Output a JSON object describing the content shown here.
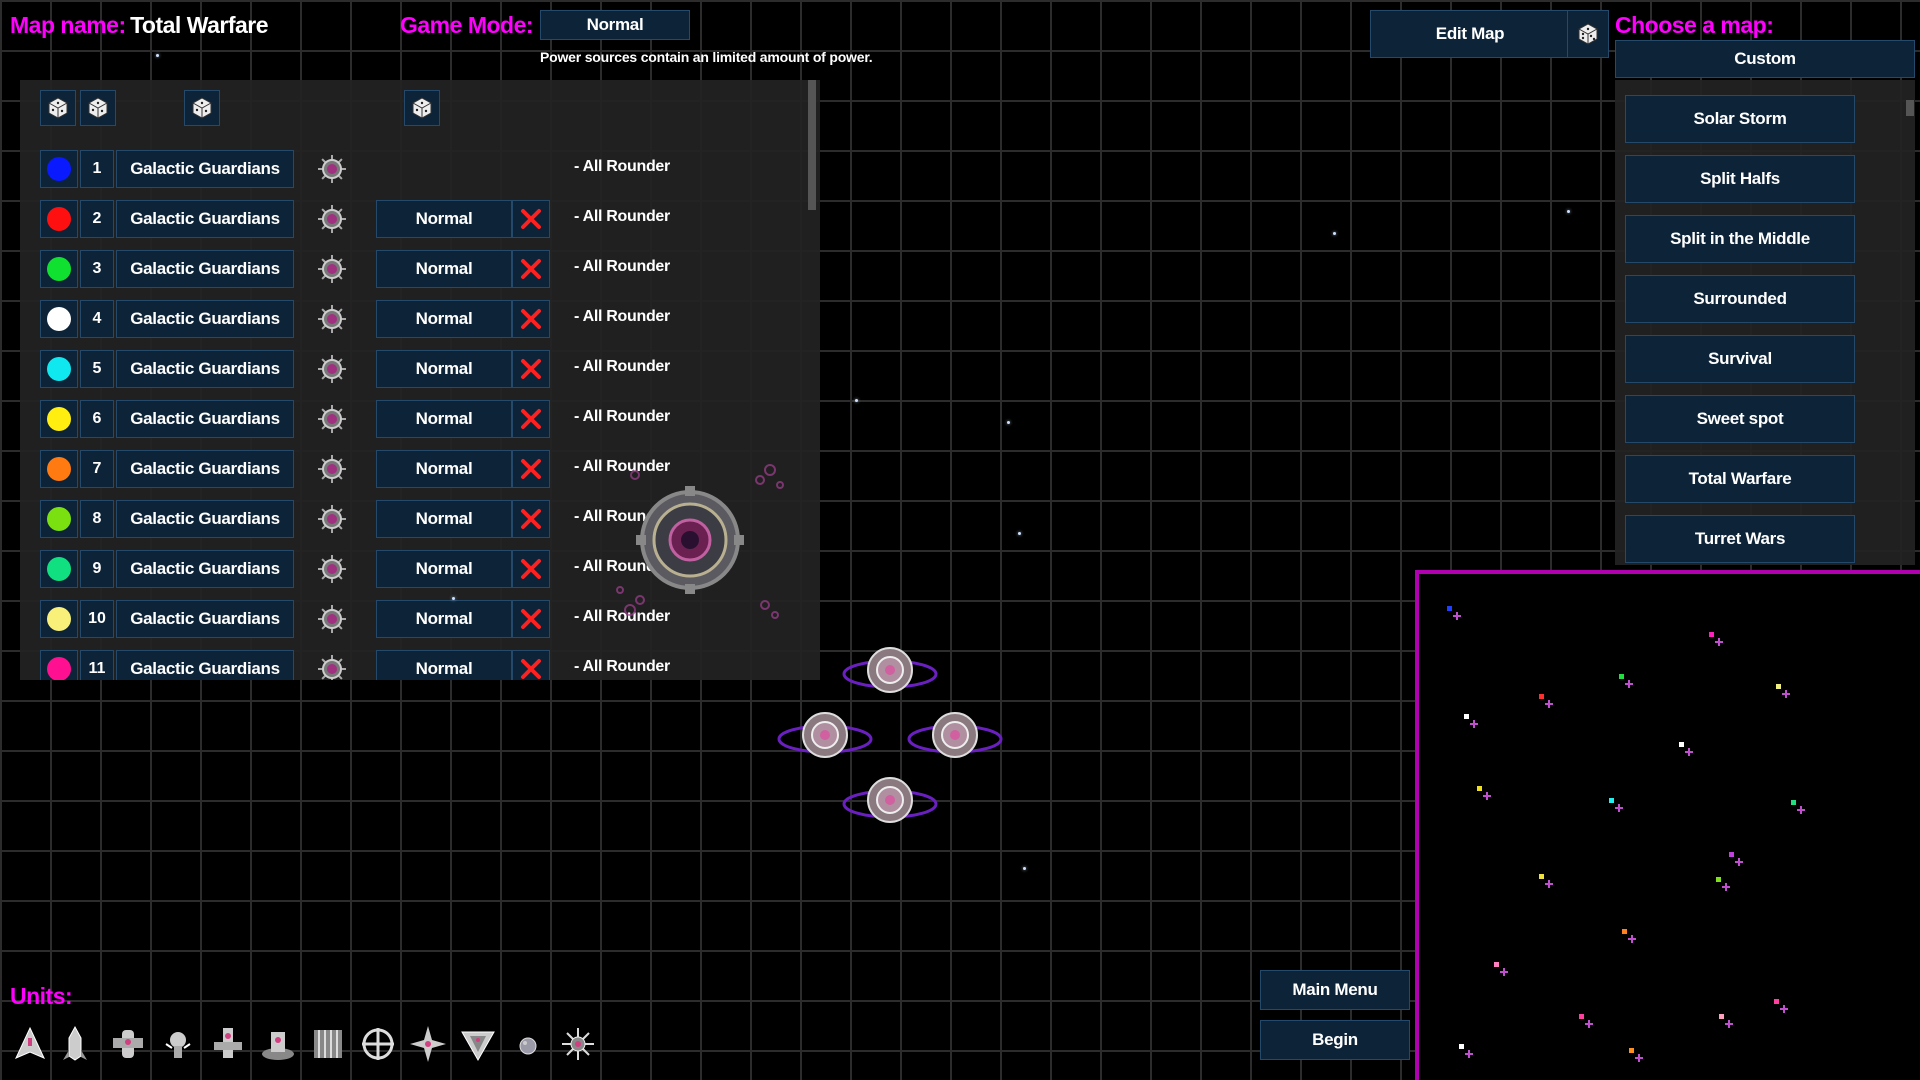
{
  "header": {
    "map_name_label": "Map name:",
    "map_name_value": "Total Warfare",
    "game_mode_label": "Game Mode:",
    "game_mode_value": "Normal",
    "game_mode_description": "Power sources contain an limited amount of power.",
    "edit_map_label": "Edit Map"
  },
  "players": [
    {
      "color": "#0a1aff",
      "number": "1",
      "team": "Galactic Guardians",
      "difficulty": "",
      "strategy": "- All Rounder"
    },
    {
      "color": "#ff1010",
      "number": "2",
      "team": "Galactic Guardians",
      "difficulty": "Normal",
      "strategy": "- All Rounder"
    },
    {
      "color": "#10e030",
      "number": "3",
      "team": "Galactic Guardians",
      "difficulty": "Normal",
      "strategy": "- All Rounder"
    },
    {
      "color": "#ffffff",
      "number": "4",
      "team": "Galactic Guardians",
      "difficulty": "Normal",
      "strategy": "- All Rounder"
    },
    {
      "color": "#10e8f0",
      "number": "5",
      "team": "Galactic Guardians",
      "difficulty": "Normal",
      "strategy": "- All Rounder"
    },
    {
      "color": "#ffee10",
      "number": "6",
      "team": "Galactic Guardians",
      "difficulty": "Normal",
      "strategy": "- All Rounder"
    },
    {
      "color": "#ff7a10",
      "number": "7",
      "team": "Galactic Guardians",
      "difficulty": "Normal",
      "strategy": "- All Rounder"
    },
    {
      "color": "#7ae010",
      "number": "8",
      "team": "Galactic Guardians",
      "difficulty": "Normal",
      "strategy": "- All Rounder"
    },
    {
      "color": "#10e080",
      "number": "9",
      "team": "Galactic Guardians",
      "difficulty": "Normal",
      "strategy": "- All Rounder"
    },
    {
      "color": "#f8f078",
      "number": "10",
      "team": "Galactic Guardians",
      "difficulty": "Normal",
      "strategy": "- All Rounder"
    },
    {
      "color": "#ff1090",
      "number": "11",
      "team": "Galactic Guardians",
      "difficulty": "Normal",
      "strategy": "- All Rounder"
    }
  ],
  "map_chooser": {
    "title": "Choose a map:",
    "selected": "Custom",
    "maps": [
      "Solar Storm",
      "Split Halfs",
      "Split in the Middle",
      "Surrounded",
      "Survival",
      "Sweet spot",
      "Total Warfare",
      "Turret Wars"
    ]
  },
  "units": {
    "label": "Units:",
    "icons": [
      "fighter-ship-icon",
      "rocket-ship-icon",
      "gunship-icon",
      "drone-ship-icon",
      "cruiser-ship-icon",
      "carrier-ship-icon",
      "tank-ship-icon",
      "crosshair-turret-icon",
      "star-fighter-icon",
      "arrow-ship-icon",
      "planet-icon",
      "sun-station-icon"
    ]
  },
  "footer": {
    "main_menu_label": "Main Menu",
    "begin_label": "Begin"
  },
  "colors": {
    "accent": "#ff00ff",
    "button_bg": "#0d2338",
    "minimap_border": "#b000b0"
  }
}
